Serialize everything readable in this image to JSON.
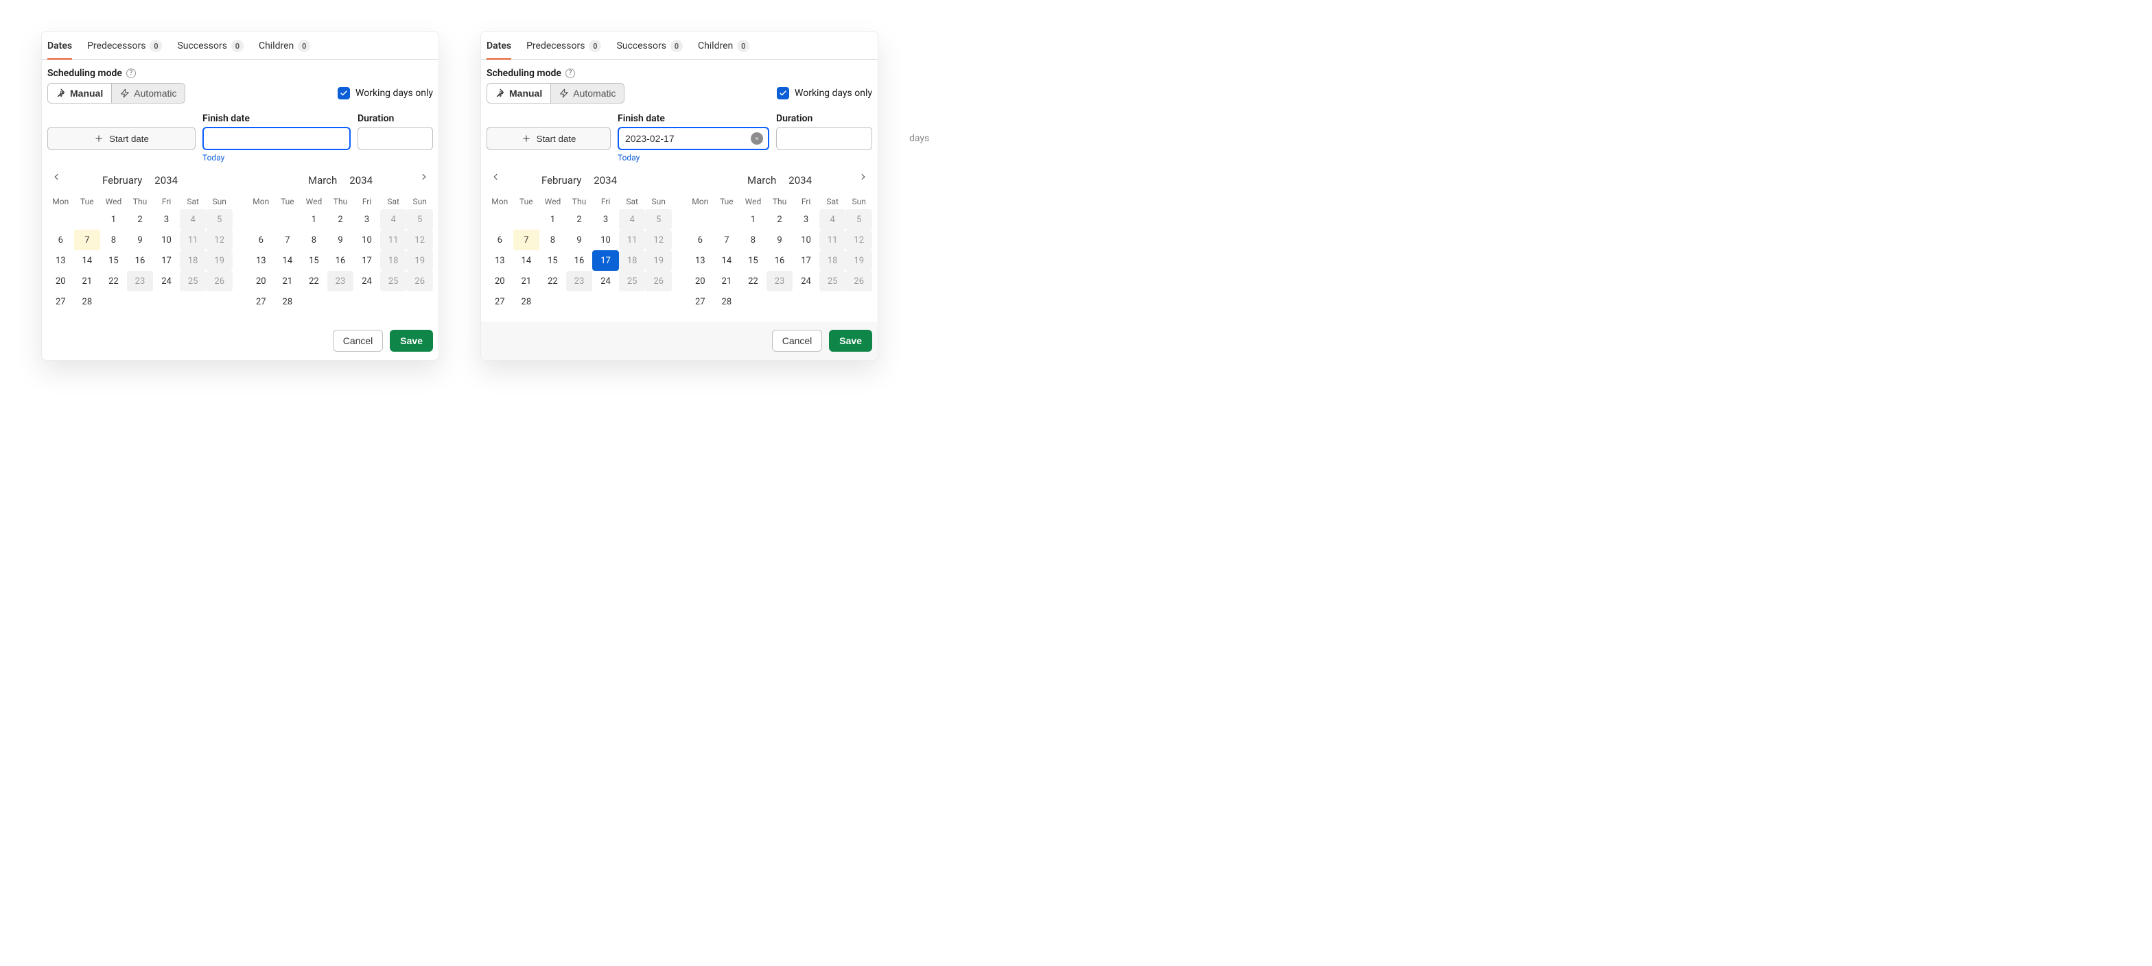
{
  "tabs": [
    {
      "label": "Dates",
      "badge": null
    },
    {
      "label": "Predecessors",
      "badge": "0"
    },
    {
      "label": "Successors",
      "badge": "0"
    },
    {
      "label": "Children",
      "badge": "0"
    }
  ],
  "scheduling": {
    "label": "Scheduling mode",
    "manual": "Manual",
    "automatic": "Automatic",
    "working_days_only": "Working days only"
  },
  "fields": {
    "start_date": "Start date",
    "finish_date": "Finish date",
    "duration": "Duration",
    "today_link": "Today",
    "days_unit": "days"
  },
  "calendar": {
    "dow": [
      "Mon",
      "Tue",
      "Wed",
      "Thu",
      "Fri",
      "Sat",
      "Sun"
    ],
    "feb": {
      "name": "February",
      "year": "2034"
    },
    "mar": {
      "name": "March",
      "year": "2034"
    }
  },
  "buttons": {
    "cancel": "Cancel",
    "save": "Save"
  },
  "panels": {
    "left": {
      "finish_value": "",
      "duration_value": "",
      "has_clear": false,
      "has_days_suffix": false,
      "selected_day": null
    },
    "right": {
      "finish_value": "2023-02-17",
      "duration_value": "",
      "has_clear": true,
      "has_days_suffix": true,
      "selected_day": 17
    }
  }
}
